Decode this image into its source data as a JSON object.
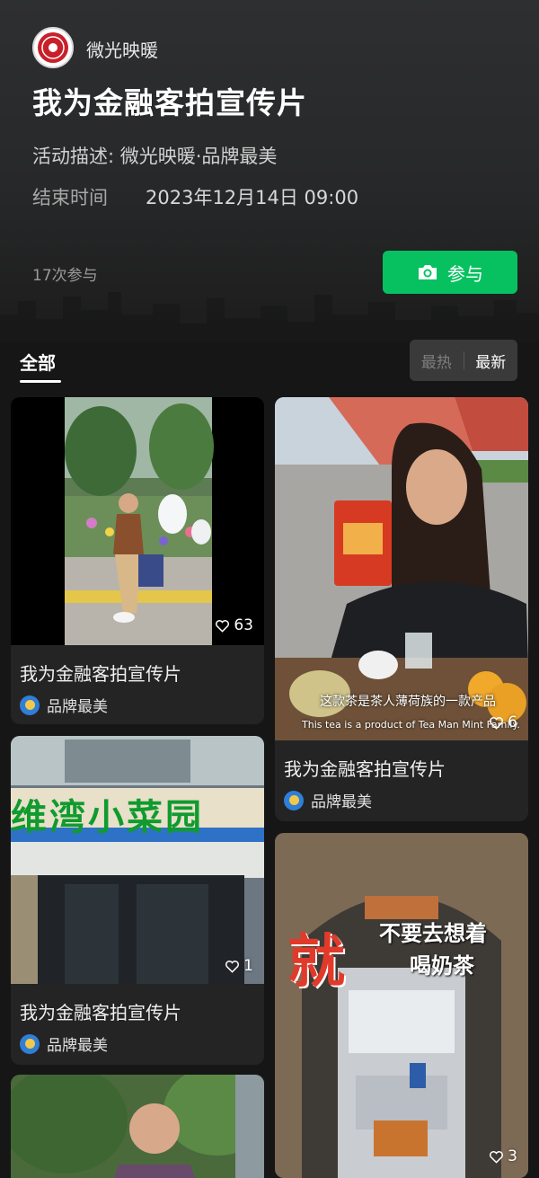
{
  "header": {
    "org_name": "微光映暖",
    "title": "我为金融客拍宣传片",
    "description": "活动描述: 微光映暖·品牌最美",
    "end_label": "结束时间",
    "end_value": "2023年12月14日 09:00",
    "participation_count": "17次参与",
    "join_label": "参与",
    "join_color": "#07c160"
  },
  "tabs": {
    "all": "全部",
    "sort_hot": "最热",
    "sort_new": "最新"
  },
  "posts": [
    {
      "title": "我为金融客拍宣传片",
      "brand": "品牌最美",
      "likes": "63"
    },
    {
      "title": "我为金融客拍宣传片",
      "brand": "品牌最美",
      "likes": "6",
      "caption_cn": "这款茶是茶人薄荷族的一款产品",
      "caption_en": "This tea is a product of Tea Man Mint Family."
    },
    {
      "title": "我为金融客拍宣传片",
      "brand": "品牌最美",
      "likes": "1",
      "sign": "维湾小菜园"
    },
    {
      "likes": "3",
      "overlay_big": "就",
      "overlay_line1": "不要去想着",
      "overlay_line2": "喝奶茶"
    },
    {}
  ],
  "icons": {
    "like": "heart-outline-icon",
    "camera": "camera-icon"
  }
}
